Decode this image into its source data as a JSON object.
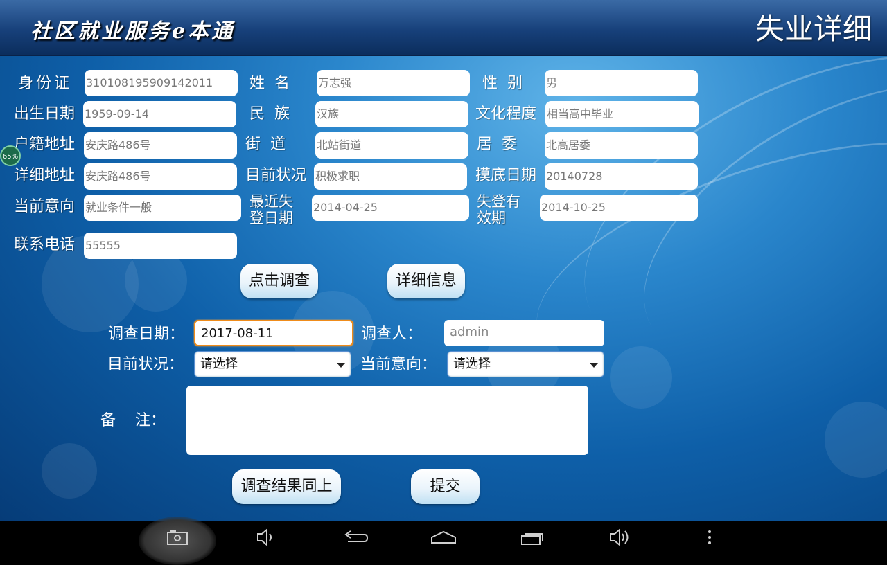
{
  "header": {
    "app_title": "社区就业服务e本通",
    "page_title": "失业详细"
  },
  "progress_badge": "65%",
  "info": {
    "id_card": {
      "label": "身份证",
      "value": "310108195909142011"
    },
    "name": {
      "label": "姓  名",
      "value": "万志强"
    },
    "gender": {
      "label": "性  别",
      "value": "男"
    },
    "birth_date": {
      "label": "出生日期",
      "value": "1959-09-14"
    },
    "ethnicity": {
      "label": "民  族",
      "value": "汉族"
    },
    "education": {
      "label": "文化程度",
      "value": "相当高中毕业"
    },
    "household_address": {
      "label": "户籍地址",
      "value": "安庆路486号"
    },
    "street": {
      "label": "街  道",
      "value": "北站街道"
    },
    "committee": {
      "label": "居  委",
      "value": "北高居委"
    },
    "detail_address": {
      "label": "详细地址",
      "value": "安庆路486号"
    },
    "current_status": {
      "label": "目前状况",
      "value": "积极求职"
    },
    "survey_base_date": {
      "label": "摸底日期",
      "value": "20140728"
    },
    "current_intention": {
      "label": "当前意向",
      "value": "就业条件一般"
    },
    "recent_registration_date": {
      "label_line1": "最近失",
      "label_line2": "登日期",
      "value": "2014-04-25"
    },
    "registration_valid": {
      "label_line1": "失登有",
      "label_line2": "效期",
      "value": "2014-10-25"
    },
    "phone": {
      "label": "联系电话",
      "value": "55555"
    }
  },
  "buttons": {
    "survey": "点击调查",
    "details": "详细信息",
    "same_as_above": "调查结果同上",
    "submit": "提交"
  },
  "survey": {
    "date_label": "调查日期：",
    "date_value": "2017-08-11",
    "surveyor_label": "调查人：",
    "surveyor_value": "admin",
    "status_label": "目前状况：",
    "status_selected": "请选择",
    "intention_label": "当前意向：",
    "intention_selected": "请选择",
    "remarks_label": "备    注：",
    "remarks_value": ""
  },
  "navbar": {
    "icons": [
      "screenshot-icon",
      "volume-down-icon",
      "back-icon",
      "home-icon",
      "recent-apps-icon",
      "volume-up-icon",
      "menu-icon"
    ]
  }
}
